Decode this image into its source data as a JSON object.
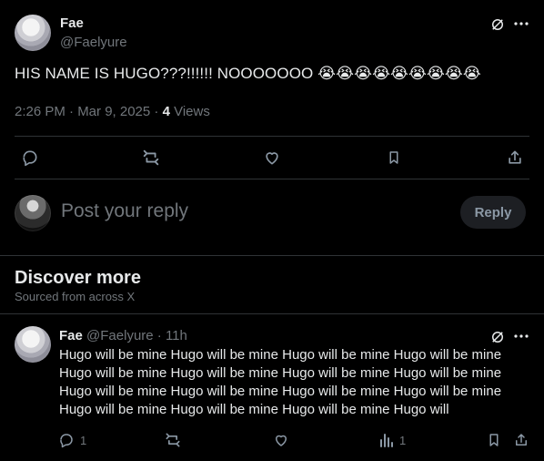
{
  "post": {
    "display_name": "Fae",
    "handle": "@Faelyure",
    "text": "HIS NAME IS HUGO???!!!!!! NOOOOOOO 😭😭😭😭😭😭😭😭😭",
    "time": "2:26 PM · Mar 9, 2025 · ",
    "views_count": "4",
    "views_label": " Views"
  },
  "compose": {
    "placeholder": "Post your reply",
    "reply_label": "Reply"
  },
  "discover": {
    "title": "Discover more",
    "subtitle": "Sourced from across X"
  },
  "feed_item": {
    "display_name": "Fae",
    "handle": "@Faelyure",
    "time": " · 11h",
    "text": "Hugo will be mine Hugo will be mine Hugo will be mine Hugo will be mine\nHugo will be mine Hugo will be mine Hugo will be mine Hugo will be mine\nHugo will be mine Hugo will be mine Hugo will be mine Hugo will be mine\nHugo will be mine Hugo will be mine Hugo will be mine Hugo will",
    "reply_count": "1",
    "views_count": "1"
  },
  "icons": {
    "grok": "grok-icon",
    "more": "more-icon",
    "reply": "reply-icon",
    "repost": "repost-icon",
    "like": "like-icon",
    "bookmark": "bookmark-icon",
    "share": "share-icon",
    "views": "views-icon"
  },
  "colors": {
    "background": "#000000",
    "text": "#e7e9ea",
    "muted": "#71767b",
    "divider": "#2f3336",
    "reply_button_bg": "#1d1f23"
  }
}
